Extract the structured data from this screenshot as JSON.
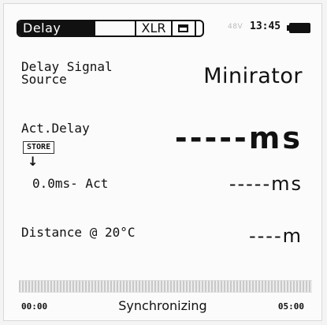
{
  "header": {
    "active_tab": "Delay",
    "connector": "XLR",
    "connector_icon": "device-icon",
    "phantom_power": "48V",
    "clock": "13:45",
    "battery_icon": "battery-full-icon"
  },
  "source": {
    "label_line1": "Delay Signal",
    "label_line2": "Source",
    "value": "Minirator"
  },
  "act_delay": {
    "label": "Act.Delay",
    "value": "-----ms",
    "store_label": "STORE",
    "arrow": "↓",
    "stored_label": "0.0ms- Act",
    "stored_value": "-----ms"
  },
  "distance": {
    "label": "Distance @  20°C",
    "value": "----m"
  },
  "progress": {
    "fraction": 0.0,
    "start_time": "00:00",
    "end_time": "05:00",
    "status": "Synchronizing"
  }
}
